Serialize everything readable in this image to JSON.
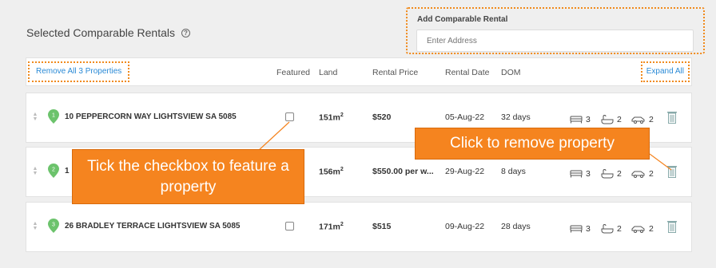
{
  "section": {
    "title": "Selected Comparable Rentals",
    "help_icon": "question-circle-icon"
  },
  "add_rental": {
    "label": "Add Comparable Rental",
    "placeholder": "Enter Address"
  },
  "table": {
    "remove_all": "Remove All 3 Properties",
    "expand_all": "Expand All",
    "headers": {
      "featured": "Featured",
      "land": "Land",
      "rental_price": "Rental Price",
      "rental_date": "Rental Date",
      "dom": "DOM"
    }
  },
  "rows": [
    {
      "num": "1",
      "address": "10 PEPPERCORN WAY LIGHTSVIEW SA 5085",
      "land": "151m",
      "land_unit": "2",
      "price": "$520",
      "date": "05-Aug-22",
      "dom": "32 days",
      "beds": "3",
      "baths": "2",
      "cars": "2"
    },
    {
      "num": "2",
      "address": "1",
      "land": "156m",
      "land_unit": "2",
      "price": "$550.00 per w...",
      "date": "29-Aug-22",
      "dom": "8 days",
      "beds": "3",
      "baths": "2",
      "cars": "2"
    },
    {
      "num": "3",
      "address": "26 BRADLEY TERRACE LIGHTSVIEW SA 5085",
      "land": "171m",
      "land_unit": "2",
      "price": "$515",
      "date": "09-Aug-22",
      "dom": "28 days",
      "beds": "3",
      "baths": "2",
      "cars": "2"
    }
  ],
  "callouts": {
    "checkbox": "Tick the checkbox to feature a property",
    "remove": "Click to remove property"
  },
  "colors": {
    "accent_orange": "#f5841f",
    "link_blue": "#2a8ad6",
    "pin_green": "#6cc36c"
  }
}
